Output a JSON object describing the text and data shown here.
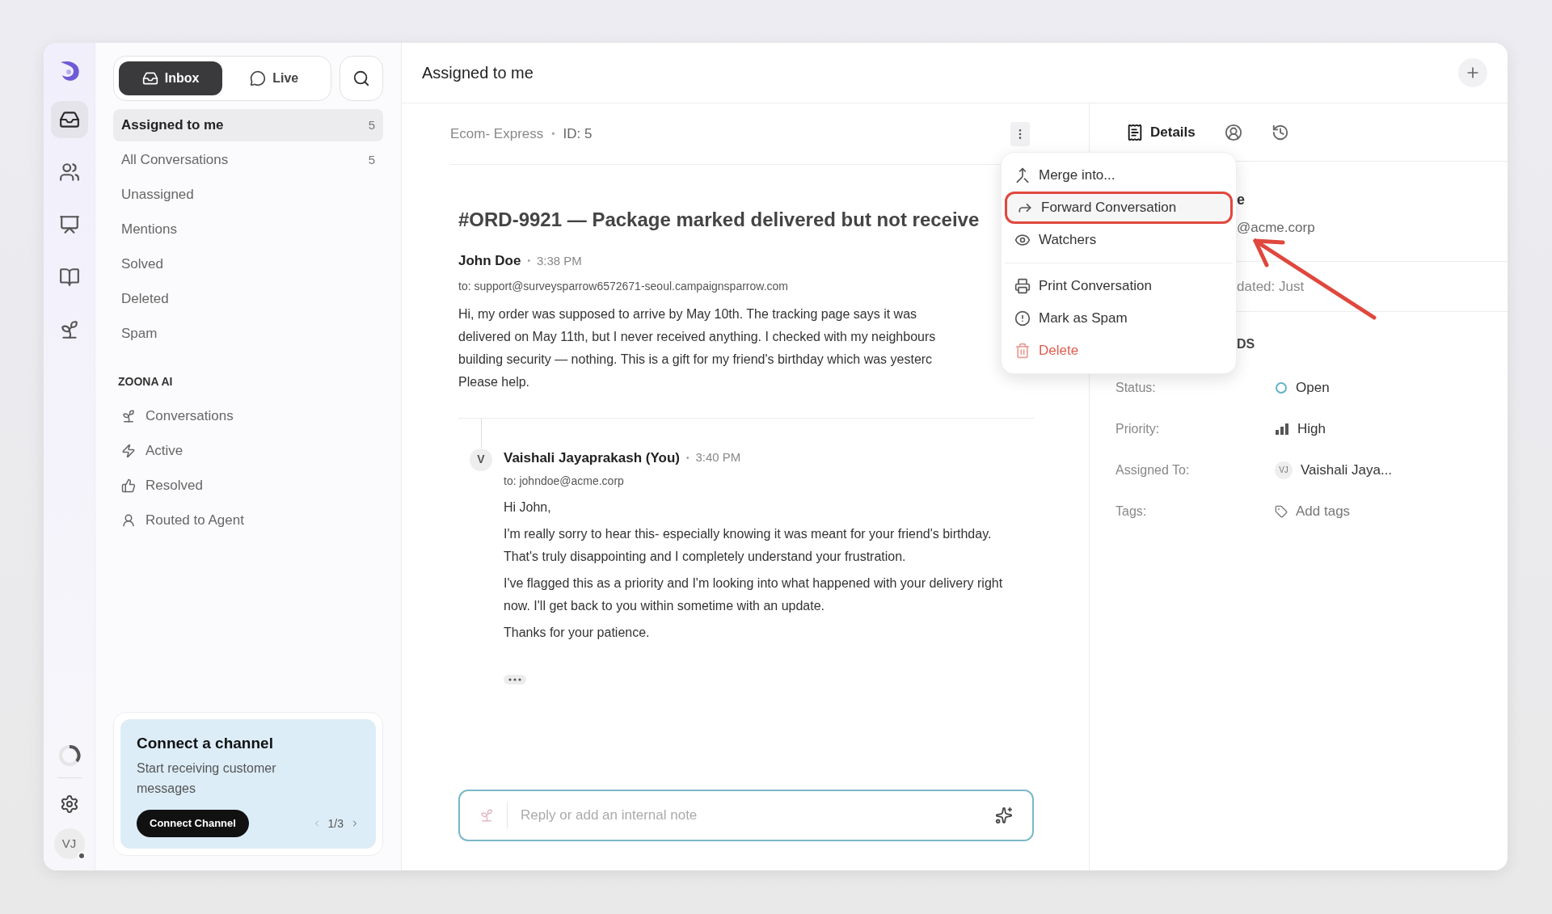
{
  "rail": {
    "items": [
      {
        "kind": "inbox",
        "selected": true
      },
      {
        "kind": "people",
        "selected": false
      },
      {
        "kind": "reports",
        "selected": false
      },
      {
        "kind": "book",
        "selected": false
      },
      {
        "kind": "ai",
        "selected": false
      }
    ],
    "avatar": "VJ"
  },
  "mode_tabs": [
    {
      "label": "Inbox",
      "kind": "inbox",
      "selected": true
    },
    {
      "label": "Live",
      "kind": "live",
      "selected": false
    }
  ],
  "nav": [
    {
      "label": "Assigned to me",
      "count": "5",
      "selected": true
    },
    {
      "label": "All Conversations",
      "count": "5",
      "selected": false
    },
    {
      "label": "Unassigned",
      "selected": false
    },
    {
      "label": "Mentions",
      "selected": false
    },
    {
      "label": "Solved",
      "selected": false
    },
    {
      "label": "Deleted",
      "selected": false
    },
    {
      "label": "Spam",
      "selected": false
    }
  ],
  "ai_section": {
    "title": "ZOONA AI",
    "items": [
      {
        "label": "Conversations",
        "kind": "ai"
      },
      {
        "label": "Active",
        "kind": "bolt"
      },
      {
        "label": "Resolved",
        "kind": "thumb"
      },
      {
        "label": "Routed to Agent",
        "kind": "agent"
      }
    ]
  },
  "promo": {
    "title": "Connect a channel",
    "text": "Start receiving customer messages",
    "button": "Connect Channel",
    "pager": "1/3"
  },
  "header": {
    "title": "Assigned to me"
  },
  "conversation": {
    "separator": "•",
    "source": "Ecom- Express",
    "id": "ID: 5",
    "title": "#ORD-9921 — Package marked delivered but not receive",
    "messages": [
      {
        "author": "John Doe",
        "time": "3:38 PM",
        "to": "to: support@surveysparrow6572671-seoul.campaignsparrow.com",
        "lines": [
          "Hi, my order was supposed to arrive by May 10th. The tracking page says it was",
          "delivered on May 11th, but I never received anything. I checked with my neighbours",
          "building security — nothing. This is a gift for my friend's birthday which was yesterc",
          "Please help."
        ]
      },
      {
        "avatar": "V",
        "author": "Vaishali Jayaprakash (You)",
        "time": "3:40 PM",
        "to": "to: johndoe@acme.corp",
        "paragraphs": [
          "Hi John,",
          "I'm really sorry to hear this- especially knowing it was meant for your friend's birthday. That's truly disappointing and I completely understand your frustration.",
          "I've flagged this as a priority and I'm looking into what happened with your delivery right now. I'll get back to you within sometime with an update.",
          "Thanks for your patience."
        ]
      }
    ],
    "reply_placeholder": "Reply or add an internal note"
  },
  "menu": {
    "groups": [
      [
        {
          "label": "Merge into...",
          "kind": "merge",
          "highlighted": false,
          "danger": false
        },
        {
          "label": "Forward Conversation",
          "kind": "forward",
          "highlighted": true,
          "danger": false
        },
        {
          "label": "Watchers",
          "kind": "watch",
          "highlighted": false,
          "danger": false
        }
      ],
      [
        {
          "label": "Print Conversation",
          "kind": "print",
          "highlighted": false,
          "danger": false
        },
        {
          "label": "Mark as Spam",
          "kind": "spam",
          "highlighted": false,
          "danger": false
        },
        {
          "label": "Delete",
          "kind": "delete",
          "highlighted": false,
          "danger": true
        }
      ]
    ]
  },
  "details": {
    "tabs": [
      {
        "label": "Details",
        "kind": "details",
        "selected": true
      },
      {
        "kind": "contact",
        "selected": false
      },
      {
        "kind": "history",
        "selected": false
      }
    ],
    "contact_name": "e",
    "contact_email": "@acme.corp",
    "updated": "dated: Just",
    "section": "DS",
    "fields": [
      {
        "label": "Status:",
        "value": "Open",
        "kind": "status"
      },
      {
        "label": "Priority:",
        "value": "High",
        "kind": "priority"
      },
      {
        "label": "Assigned To:",
        "value": "Vaishali Jaya...",
        "kind": "assignee",
        "avatar": "VJ"
      },
      {
        "label": "Tags:",
        "value": "Add tags",
        "kind": "tags"
      }
    ]
  }
}
